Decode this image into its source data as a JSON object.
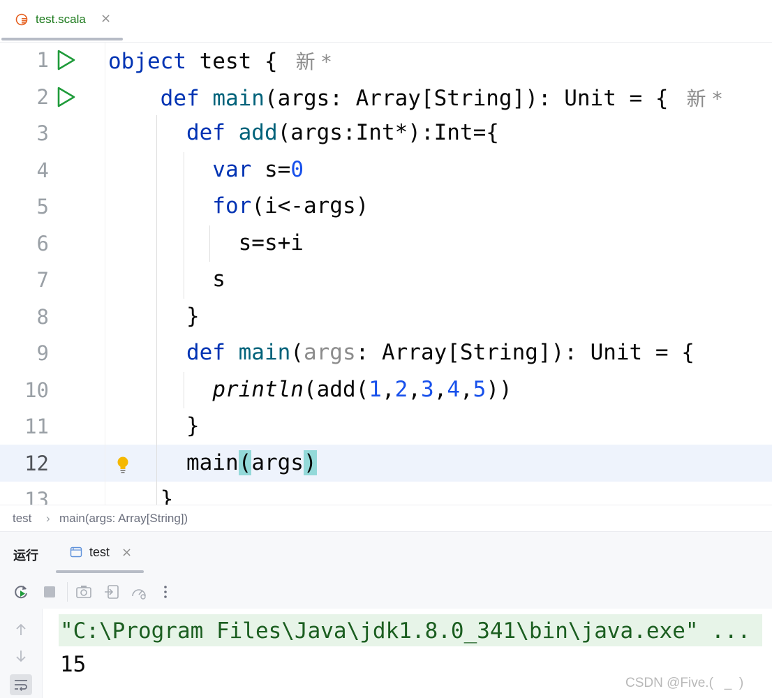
{
  "tabs": [
    {
      "label": "test.scala",
      "icon": "scala-file-icon",
      "close": "×"
    }
  ],
  "editor": {
    "lines": [
      {
        "number": "1",
        "tokens": [
          {
            "t": "object",
            "c": "kw"
          },
          {
            "t": " test {",
            "c": ""
          }
        ],
        "hint": "新 *",
        "run": true
      },
      {
        "number": "2",
        "tokens": [
          {
            "t": "    def ",
            "c": "kw"
          },
          {
            "t": "main",
            "c": "fn"
          },
          {
            "t": "(args: Array[String]): Unit = {",
            "c": ""
          }
        ],
        "hint": "新 *",
        "run": true
      },
      {
        "number": "3",
        "tokens": [
          {
            "t": "      def ",
            "c": "kw"
          },
          {
            "t": "add",
            "c": "fn"
          },
          {
            "t": "(args:Int*):Int={",
            "c": ""
          }
        ]
      },
      {
        "number": "4",
        "tokens": [
          {
            "t": "        var",
            "c": "kw"
          },
          {
            "t": " s=",
            "c": ""
          },
          {
            "t": "0",
            "c": "num"
          }
        ]
      },
      {
        "number": "5",
        "tokens": [
          {
            "t": "        for",
            "c": "kw"
          },
          {
            "t": "(i<-args)",
            "c": ""
          }
        ]
      },
      {
        "number": "6",
        "tokens": [
          {
            "t": "          s=s+i",
            "c": ""
          }
        ]
      },
      {
        "number": "7",
        "tokens": [
          {
            "t": "        s",
            "c": ""
          }
        ]
      },
      {
        "number": "8",
        "tokens": [
          {
            "t": "      }",
            "c": ""
          }
        ]
      },
      {
        "number": "9",
        "tokens": [
          {
            "t": "      def ",
            "c": "kw"
          },
          {
            "t": "main",
            "c": "fn"
          },
          {
            "t": "(",
            "c": ""
          },
          {
            "t": "args",
            "c": "param"
          },
          {
            "t": ": Array[String]): Unit = {",
            "c": ""
          }
        ]
      },
      {
        "number": "10",
        "tokens": [
          {
            "t": "        ",
            "c": ""
          },
          {
            "t": "println",
            "c": "ital"
          },
          {
            "t": "(add(",
            "c": ""
          },
          {
            "t": "1",
            "c": "num"
          },
          {
            "t": ",",
            "c": ""
          },
          {
            "t": "2",
            "c": "num"
          },
          {
            "t": ",",
            "c": ""
          },
          {
            "t": "3",
            "c": "num"
          },
          {
            "t": ",",
            "c": ""
          },
          {
            "t": "4",
            "c": "num"
          },
          {
            "t": ",",
            "c": ""
          },
          {
            "t": "5",
            "c": "num"
          },
          {
            "t": "))",
            "c": ""
          }
        ]
      },
      {
        "number": "11",
        "tokens": [
          {
            "t": "      }",
            "c": ""
          }
        ]
      },
      {
        "number": "12",
        "tokens": [
          {
            "t": "      main",
            "c": ""
          },
          {
            "t": "(",
            "c": "brace-hl"
          },
          {
            "t": "args",
            "c": ""
          },
          {
            "t": ")",
            "c": "brace-hl"
          }
        ],
        "active": true,
        "bulb": true
      },
      {
        "number": "13",
        "tokens": [
          {
            "t": "    }",
            "c": ""
          }
        ]
      }
    ]
  },
  "breadcrumb": {
    "items": [
      "test",
      "main(args: Array[String])"
    ],
    "separator": "›"
  },
  "run_panel": {
    "title": "运行",
    "tab_label": "test",
    "tab_close": "×",
    "toolbar": [
      "rerun-icon",
      "stop-icon",
      "screenshot-icon",
      "restore-layout-icon",
      "performance-icon",
      "more-icon"
    ],
    "console": {
      "command": "\"C:\\Program Files\\Java\\jdk1.8.0_341\\bin\\java.exe\" ...",
      "output": "15"
    }
  },
  "watermark": "CSDN @Five.(   _  )",
  "colors": {
    "keyword": "#0033b3",
    "function": "#00627a",
    "number": "#1750eb",
    "run_green": "#1f9b3a",
    "current_line": "#eef3fc"
  }
}
